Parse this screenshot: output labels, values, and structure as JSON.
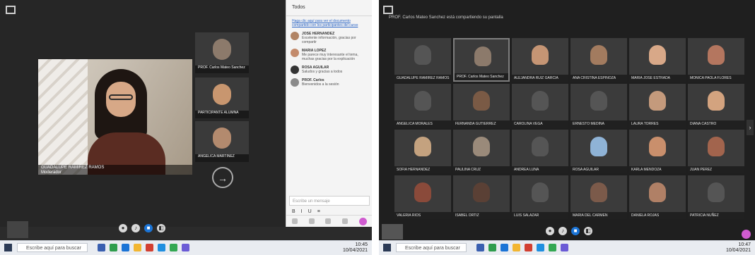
{
  "left": {
    "main_speaker": {
      "name": "GUADALUPE RAMIREZ RAMOS",
      "role": "Moderador"
    },
    "tiles": [
      {
        "name": "PROF. Carlos Mateo Sanchez",
        "role": "Moderador"
      },
      {
        "name": "PARTICIPANTE ALUMNA"
      },
      {
        "name": "ANGELICA MARTINEZ"
      }
    ],
    "next_label": "→",
    "chat": {
      "title": "Todos",
      "intro_link": "Haga clic aquí para ver el documento compartido con los participantes del curso",
      "messages": [
        {
          "name": "JOSE HERNANDEZ",
          "text": "Excelente información, gracias por compartir"
        },
        {
          "name": "MARIA LOPEZ",
          "text": "Me parece muy interesante el tema, muchas gracias por la explicación"
        },
        {
          "name": "ROSA AGUILAR",
          "text": "Saludos y gracias a todos"
        },
        {
          "name": "PROF. Carlos",
          "text": "Bienvenidos a la sesión"
        }
      ],
      "input_placeholder": "Escribe un mensaje",
      "format": [
        "B",
        "I",
        "U",
        "≡"
      ]
    },
    "taskbar": {
      "search": "Escribe aquí para buscar",
      "time": "10:45",
      "date": "10/04/2021"
    }
  },
  "right": {
    "title": "PROF. Carlos Mateo Sanchez está compartiendo su pantalla",
    "grid_names": [
      "GUADALUPE RAMIREZ RAMOS",
      "PROF. Carlos Mateo Sanchez",
      "ALEJANDRA RUIZ GARCIA",
      "ANA CRISTINA ESPINOZA",
      "MARIA JOSE ESTRADA",
      "MONICA PAOLA FLORES",
      "ANGELICA MORALES",
      "FERNANDA GUTIERREZ",
      "CAROLINA VEGA",
      "ERNESTO MEDINA",
      "LAURA TORRES",
      "DIANA CASTRO",
      "SOFIA HERNANDEZ",
      "PAULINA CRUZ",
      "ANDREA LUNA",
      "ROSA AGUILAR",
      "KARLA MENDOZA",
      "JUAN PEREZ",
      "VALERIA RIOS",
      "ISABEL ORTIZ",
      "LUIS SALAZAR",
      "MARIA DEL CARMEN",
      "DANIELA ROJAS",
      "PATRICIA NUÑEZ"
    ],
    "taskbar": {
      "search": "Escribe aquí para buscar",
      "time": "10:47",
      "date": "10/04/2021"
    }
  },
  "colors": {
    "accent_pink": "#d05bd0",
    "controls_blue": "#1b74d6"
  }
}
